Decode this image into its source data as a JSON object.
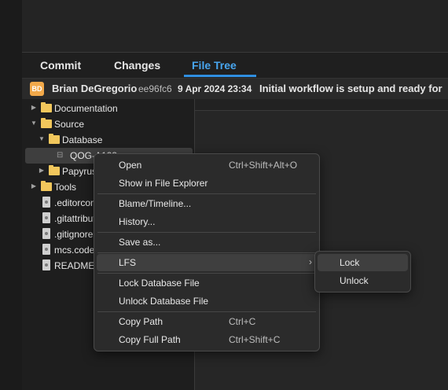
{
  "tabs": [
    {
      "label": "Commit",
      "active": false
    },
    {
      "label": "Changes",
      "active": false
    },
    {
      "label": "File Tree",
      "active": true
    }
  ],
  "colors": {
    "accent": "#48a6ef",
    "folder": "#f2c75c",
    "avatar": "#f2a94a"
  },
  "commit": {
    "avatar_initials": "BD",
    "author": "Brian DeGregorio",
    "sha": "ee96fc6",
    "date": "9 Apr 2024 23:34",
    "message": "Initial workflow is setup and ready for"
  },
  "tree": {
    "items": [
      {
        "label": "Documentation",
        "type": "folder",
        "expanded": false
      },
      {
        "label": "Source",
        "type": "folder",
        "expanded": true
      },
      {
        "label": "Database",
        "type": "folder",
        "expanded": true
      },
      {
        "label": "QOG-A123",
        "type": "database",
        "selected": true
      },
      {
        "label": "Papyrus",
        "type": "folder",
        "expanded": false
      },
      {
        "label": "Tools",
        "type": "folder",
        "expanded": false
      },
      {
        "label": ".editorconfig",
        "type": "file"
      },
      {
        "label": ".gitattributes",
        "type": "file"
      },
      {
        "label": ".gitignore",
        "type": "file"
      },
      {
        "label": "mcs.code-workspace",
        "type": "file"
      },
      {
        "label": "README.md",
        "type": "file"
      }
    ]
  },
  "context_menu": {
    "items": [
      {
        "label": "Open",
        "shortcut": "Ctrl+Shift+Alt+O"
      },
      {
        "label": "Show in File Explorer",
        "shortcut": ""
      },
      {
        "label": "Blame/Timeline...",
        "shortcut": ""
      },
      {
        "label": "History...",
        "shortcut": ""
      },
      {
        "label": "Save as...",
        "shortcut": ""
      },
      {
        "label": "LFS",
        "shortcut": "",
        "submenu": true,
        "arrow": "›"
      },
      {
        "label": "Lock Database File",
        "shortcut": ""
      },
      {
        "label": "Unlock Database File",
        "shortcut": ""
      },
      {
        "label": "Copy Path",
        "shortcut": "Ctrl+C"
      },
      {
        "label": "Copy Full Path",
        "shortcut": "Ctrl+Shift+C"
      }
    ]
  },
  "lfs_submenu": {
    "items": [
      {
        "label": "Lock"
      },
      {
        "label": "Unlock"
      }
    ]
  }
}
